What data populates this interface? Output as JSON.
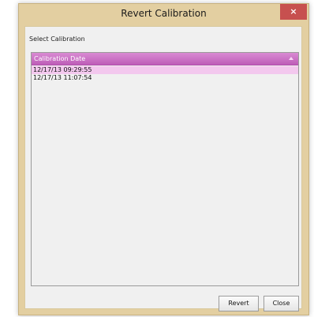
{
  "window": {
    "title": "Revert Calibration",
    "close_glyph": "×"
  },
  "section_label": "Select Calibration",
  "list": {
    "column_header": "Calibration Date",
    "rows": [
      {
        "date": "12/17/13 09:29:55",
        "selected": true
      },
      {
        "date": "12/17/13 11:07:54",
        "selected": false
      }
    ]
  },
  "buttons": {
    "revert_label": "Revert",
    "close_label": "Close"
  },
  "colors": {
    "window_frame": "#e3cfa1",
    "header_purple": "#be5db8",
    "selected_row": "#f3c8ee",
    "close_red": "#c7504f"
  },
  "icons": {
    "sort": "sort-ascending-icon",
    "close": "close-icon"
  }
}
